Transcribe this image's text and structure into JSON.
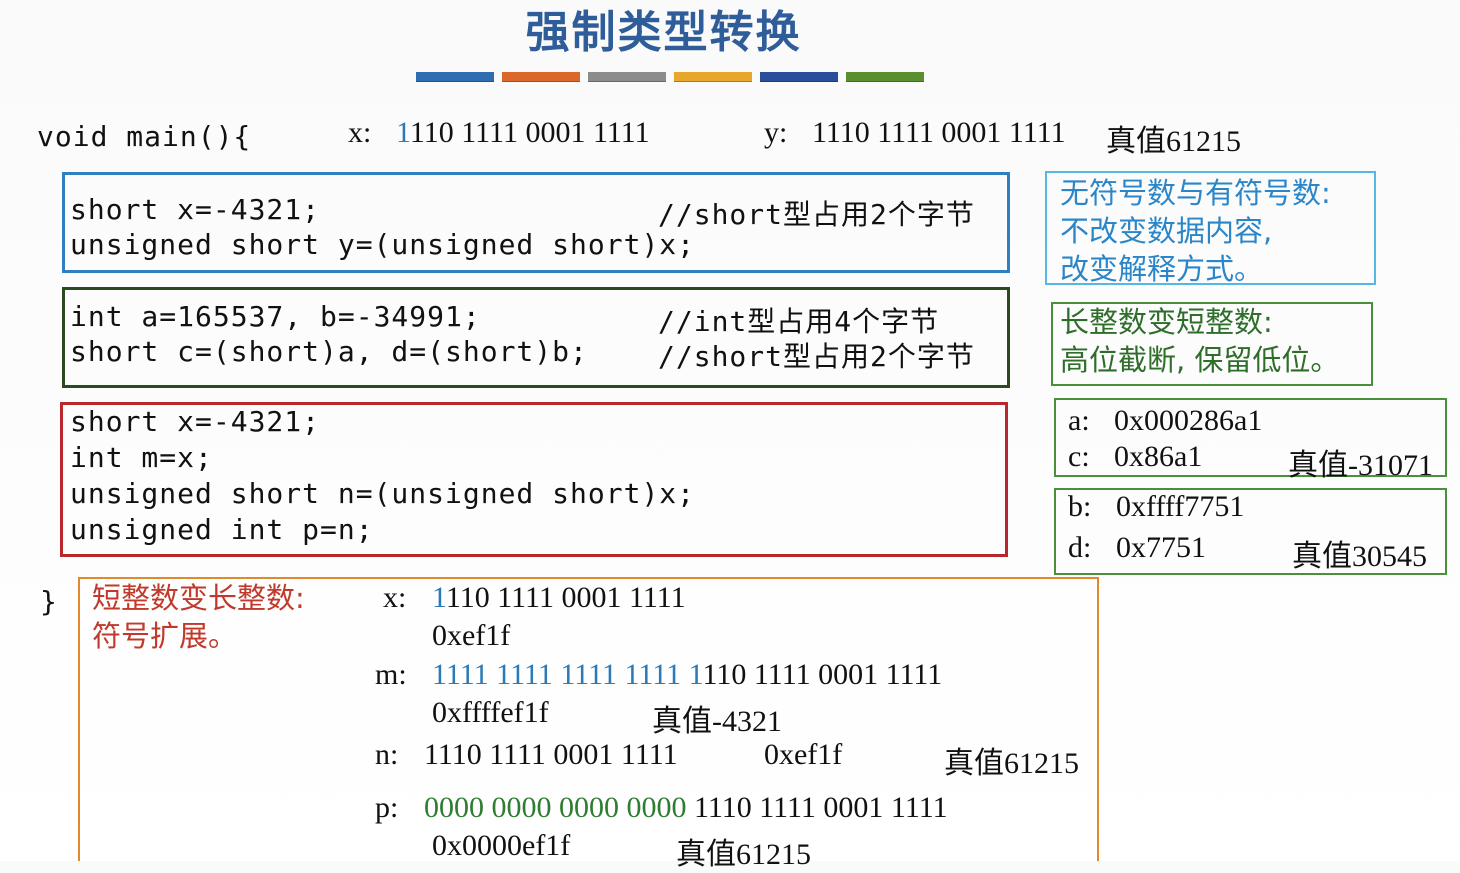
{
  "title": "强制类型转换",
  "accent_colors": [
    "#2f6db0",
    "#d9682a",
    "#8c8c8c",
    "#e6a72a",
    "#2a4f9a",
    "#5a8f2e"
  ],
  "header": {
    "func": "void main(){",
    "x_label": "x:",
    "x_lead": "1",
    "x_rest": "110 1111 0001 1111",
    "y_label": "y:",
    "y_bits": "1110 1111 0001 1111",
    "y_true": "真值61215"
  },
  "code_box1": {
    "line1": "short x=-4321;",
    "comment1": "//short型占用2个字节",
    "line2": "unsigned short y=(unsigned short)x;"
  },
  "code_box2": {
    "line1": "int a=165537, b=-34991;",
    "comment1": "//int型占用4个字节",
    "line2": "short c=(short)a, d=(short)b;",
    "comment2": "//short型占用2个字节"
  },
  "code_box3": {
    "line1": "short x=-4321;",
    "line2": "int m=x;",
    "line3": "unsigned short n=(unsigned short)x;",
    "line4": "unsigned int p=n;"
  },
  "closing_brace": "}",
  "note_signed": {
    "line1": "无符号数与有符号数:",
    "line2": "不改变数据内容,",
    "line3": "改变解释方式。"
  },
  "note_truncate": {
    "line1": "长整数变短整数:",
    "line2": "高位截断, 保留低位。"
  },
  "box_ac": {
    "a_label": "a:",
    "a_hex": "0x000286a1",
    "c_label": "c:",
    "c_hex": "0x86a1",
    "c_true": "真值-31071"
  },
  "box_bd": {
    "b_label": "b:",
    "b_hex": "0xffff7751",
    "d_label": "d:",
    "d_hex": "0x7751",
    "d_true": "真值30545"
  },
  "extend_box": {
    "note_line1": "短整数变长整数:",
    "note_line2": "符号扩展。",
    "x_label": "x:",
    "x_lead": "1",
    "x_rest": "110 1111 0001 1111",
    "x_hex": "0xef1f",
    "m_label": "m:",
    "m_ext": "1111 1111 1111 1111",
    "m_lead": "1",
    "m_rest": "110 1111 0001 1111",
    "m_hex": "0xffffef1f",
    "m_true": "真值-4321",
    "n_label": "n:",
    "n_bits": "1110 1111 0001 1111",
    "n_hex": "0xef1f",
    "n_true": "真值61215",
    "p_label": "p:",
    "p_ext": "0000 0000 0000 0000",
    "p_rest": "1110 1111 0001 1111",
    "p_hex": "0x0000ef1f",
    "p_true": "真值61215"
  }
}
